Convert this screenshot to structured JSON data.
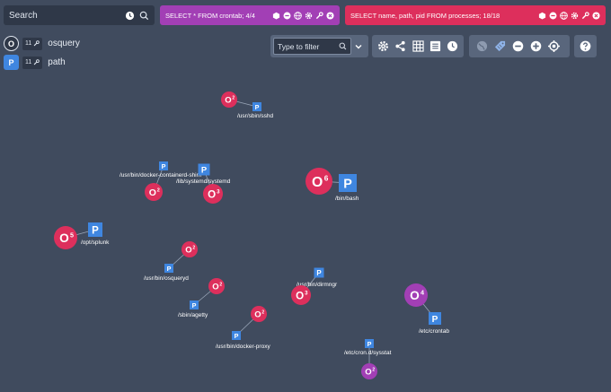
{
  "search": {
    "placeholder": "Search"
  },
  "tabs": [
    {
      "query": "SELECT * FROM crontab; 4/4",
      "color": "#a23fb5"
    },
    {
      "query": "SELECT name, path, pid FROM processes; 18/18",
      "color": "#dd2f5c"
    }
  ],
  "legend": [
    {
      "badge": "O",
      "count": "11",
      "label": "osquery",
      "color": "#2f3848"
    },
    {
      "badge": "P",
      "count": "11",
      "label": "path",
      "color": "#3f86e0"
    }
  ],
  "filter": {
    "placeholder": "Type to filter"
  },
  "colors": {
    "process_node": "#dd2f5c",
    "crontab_node": "#a23fb5",
    "path_node": "#3f86e0",
    "background": "#404b5e"
  },
  "graph": {
    "nodes": [
      {
        "id": "o1",
        "kind": "o",
        "text": "O",
        "sup": "2",
        "color": "process"
      },
      {
        "id": "p1",
        "kind": "p",
        "text": "P",
        "label": "/usr/sbin/sshd"
      },
      {
        "id": "p2",
        "kind": "p",
        "text": "P",
        "label": "/usr/bin/docker-containerd-shim"
      },
      {
        "id": "p3",
        "kind": "p",
        "text": "P",
        "label": "/lib/systemd/systemd"
      },
      {
        "id": "o2",
        "kind": "o",
        "text": "O",
        "sup": "2",
        "color": "process"
      },
      {
        "id": "o3",
        "kind": "o",
        "text": "O",
        "sup": "3",
        "color": "process"
      },
      {
        "id": "o4",
        "kind": "o",
        "text": "O",
        "sup": "6",
        "color": "process"
      },
      {
        "id": "p4",
        "kind": "p",
        "text": "P",
        "label": "/bin/bash"
      },
      {
        "id": "o5",
        "kind": "o",
        "text": "O",
        "sup": "5",
        "color": "process"
      },
      {
        "id": "p5",
        "kind": "p",
        "text": "P",
        "label": "/opt/splunk"
      },
      {
        "id": "o6",
        "kind": "o",
        "text": "O",
        "sup": "2",
        "color": "process"
      },
      {
        "id": "p6",
        "kind": "p",
        "text": "P",
        "label": "/usr/bin/osqueryd"
      },
      {
        "id": "o7",
        "kind": "o",
        "text": "O",
        "sup": "2",
        "color": "process"
      },
      {
        "id": "p7",
        "kind": "p",
        "text": "P",
        "label": "/sbin/agetty"
      },
      {
        "id": "p8",
        "kind": "p",
        "text": "P",
        "label": "/usr/bin/dirmngr"
      },
      {
        "id": "o8",
        "kind": "o",
        "text": "O",
        "sup": "3",
        "color": "process"
      },
      {
        "id": "o9",
        "kind": "o",
        "text": "O",
        "sup": "4",
        "color": "crontab"
      },
      {
        "id": "p9",
        "kind": "p",
        "text": "P",
        "label": "/etc/crontab"
      },
      {
        "id": "o10",
        "kind": "o",
        "text": "O",
        "sup": "2",
        "color": "process"
      },
      {
        "id": "p10",
        "kind": "p",
        "text": "P",
        "label": "/usr/bin/docker-proxy"
      },
      {
        "id": "p11",
        "kind": "p",
        "text": "P",
        "label": "/etc/cron.d/sysstat"
      },
      {
        "id": "o11",
        "kind": "o",
        "text": "O",
        "sup": "2",
        "color": "crontab"
      }
    ],
    "edges": [
      [
        "o1",
        "p1"
      ],
      [
        "o2",
        "p2"
      ],
      [
        "o3",
        "p3"
      ],
      [
        "o4",
        "p4"
      ],
      [
        "o5",
        "p5"
      ],
      [
        "o6",
        "p6"
      ],
      [
        "o7",
        "p7"
      ],
      [
        "o8",
        "p8"
      ],
      [
        "o9",
        "p9"
      ],
      [
        "o10",
        "p10"
      ],
      [
        "o11",
        "p11"
      ]
    ]
  }
}
